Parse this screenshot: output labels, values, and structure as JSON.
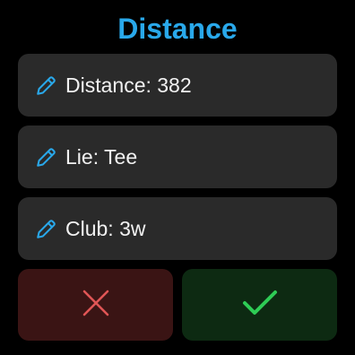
{
  "screen": {
    "title": "Distance"
  },
  "fields": [
    {
      "label": "Distance: 382",
      "icon": "pencil-icon"
    },
    {
      "label": "Lie: Tee",
      "icon": "pencil-icon"
    },
    {
      "label": "Club: 3w",
      "icon": "pencil-icon"
    }
  ],
  "actions": {
    "cancel_icon": "close-icon",
    "confirm_icon": "checkmark-icon"
  },
  "colors": {
    "accent": "#29a8ea",
    "cancel": "#e05555",
    "confirm": "#2ecc55",
    "card": "#2a2a2a"
  }
}
